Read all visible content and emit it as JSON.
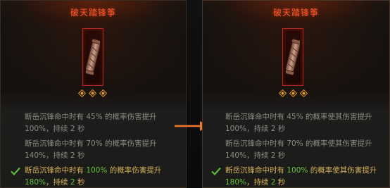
{
  "cards": [
    {
      "title": "破天踏锋筝",
      "icon": "scroll-icon",
      "sockets": 3,
      "effects": [
        {
          "text": "断岳沉锋命中时有 45% 的概率伤害提升 100%，持续 2 秒",
          "active": false
        },
        {
          "text": "断岳沉锋命中时有 70% 的概率伤害提升 140%，持续 2 秒",
          "active": false
        },
        {
          "text_a": "断岳沉锋命中时有 ",
          "hl1": "100%",
          "text_b": " 的概率伤害提升 ",
          "hl2": "180%",
          "text_c": "，持续 ",
          "hl3": "2",
          "text_d": " 秒",
          "active": true
        }
      ]
    },
    {
      "title": "破天踏锋筝",
      "icon": "scroll-icon",
      "sockets": 3,
      "effects": [
        {
          "text": "断岳沉锋命中时有 45% 的概率使其伤害提升 100%，持续 2 秒",
          "active": false
        },
        {
          "text": "断岳沉锋命中时有 70% 的概率使其伤害提升 140%，持续 2 秒",
          "active": false
        },
        {
          "text_a": "断岳沉锋命中时有 ",
          "hl1": "100%",
          "text_b": " 的概率使其伤害提升 ",
          "hl2": "180%",
          "text_c": "，持续 ",
          "hl3": "2",
          "text_d": " 秒",
          "active": true
        }
      ]
    }
  ],
  "colors": {
    "title": "#ff5a2a",
    "effect_inactive": "#8d8a85",
    "effect_active": "#d7b35a",
    "highlight": "#69c23c",
    "arrow": "#f07a28",
    "frame_border": "#b3261a"
  }
}
